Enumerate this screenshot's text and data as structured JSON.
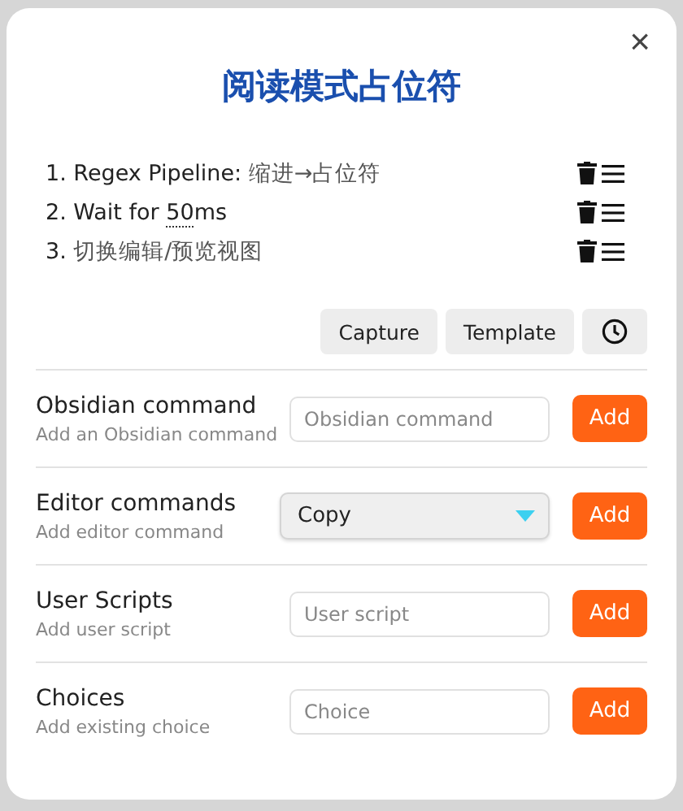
{
  "modal": {
    "title": "阅读模式占位符",
    "close": "×"
  },
  "steps": [
    {
      "parts": [
        {
          "kind": "plain",
          "text": "1. Regex Pipeline: "
        },
        {
          "kind": "muted",
          "text": "缩进→占位符"
        }
      ]
    },
    {
      "parts": [
        {
          "kind": "plain",
          "text": "2. Wait for "
        },
        {
          "kind": "editable",
          "text": "50"
        },
        {
          "kind": "plain",
          "text": "ms"
        }
      ]
    },
    {
      "parts": [
        {
          "kind": "plain",
          "text": "3. "
        },
        {
          "kind": "muted",
          "text": "切换编辑/预览视图"
        }
      ]
    }
  ],
  "actions": [
    {
      "kind": "text",
      "label": "Capture"
    },
    {
      "kind": "text",
      "label": "Template"
    },
    {
      "kind": "clock"
    }
  ],
  "settings": [
    {
      "kind": "input",
      "name": "Obsidian command",
      "description": "Add an Obsidian command",
      "placeholder": "Obsidian command",
      "button": "Add"
    },
    {
      "kind": "dropdown",
      "name": "Editor commands",
      "description": "Add editor command",
      "value": "Copy",
      "button": "Add"
    },
    {
      "kind": "input",
      "name": "User Scripts",
      "description": "Add user script",
      "placeholder": "User script",
      "button": "Add"
    },
    {
      "kind": "input",
      "name": "Choices",
      "description": "Add existing choice",
      "placeholder": "Choice",
      "button": "Add"
    }
  ]
}
